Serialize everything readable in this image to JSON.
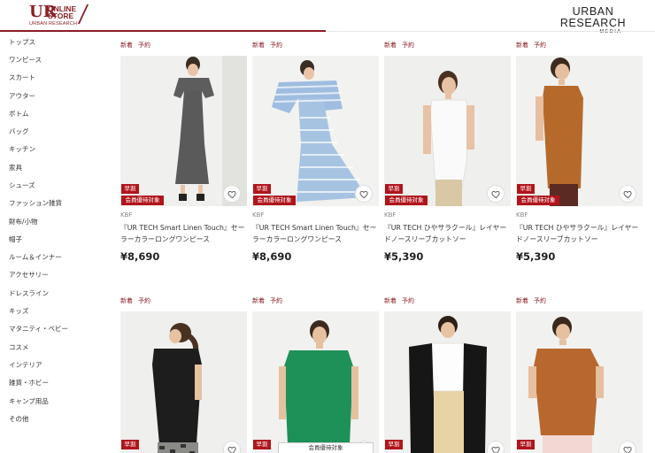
{
  "header": {
    "logo_ur": "UR",
    "logo_online": "ONLINE",
    "logo_store": "STORE",
    "logo_sub": "URBAN RESEARCH",
    "media_brand": "URBAN RESEARCH",
    "media_sub": "MEDIA"
  },
  "sidebar": {
    "items": [
      {
        "label": "トップス"
      },
      {
        "label": "ワンピース"
      },
      {
        "label": "スカート"
      },
      {
        "label": "アウター"
      },
      {
        "label": "ボトム"
      },
      {
        "label": "バッグ"
      },
      {
        "label": "キッチン"
      },
      {
        "label": "家具"
      },
      {
        "label": "シューズ"
      },
      {
        "label": "ファッション雑貨"
      },
      {
        "label": "財布/小物"
      },
      {
        "label": "帽子"
      },
      {
        "label": "ルーム＆インナー"
      },
      {
        "label": "アクセサリー"
      },
      {
        "label": "ドレスライン"
      },
      {
        "label": "キッズ"
      },
      {
        "label": "マタニティ・ベビー"
      },
      {
        "label": "コスメ"
      },
      {
        "label": "インテリア"
      },
      {
        "label": "雑貨・ホビー"
      },
      {
        "label": "キャンプ用品"
      },
      {
        "label": "その他"
      }
    ]
  },
  "products": [
    {
      "tag_new": "新着",
      "tag_reserve": "予約",
      "badge_early": "早割",
      "badge_member": "会員優待対象",
      "brand": "KBF",
      "name": "『UR TECH Smart Linen Touch』セーラーカラーロングワンピース",
      "price": "¥8,690"
    },
    {
      "tag_new": "新着",
      "tag_reserve": "予約",
      "badge_early": "早割",
      "badge_member": "会員優待対象",
      "brand": "KBF",
      "name": "『UR TECH Smart Linen Touch』セーラーカラーロングワンピース",
      "price": "¥8,690"
    },
    {
      "tag_new": "新着",
      "tag_reserve": "予約",
      "badge_early": "早割",
      "badge_member": "会員優待対象",
      "brand": "KBF",
      "name": "『UR TECH ひやサラクール』レイヤードノースリーブカットソー",
      "price": "¥5,390"
    },
    {
      "tag_new": "新着",
      "tag_reserve": "予約",
      "badge_early": "早割",
      "badge_member": "会員優待対象",
      "brand": "KBF",
      "name": "『UR TECH ひやサラクール』レイヤードノースリーブカットソー",
      "price": "¥5,390"
    },
    {
      "tag_new": "新着",
      "tag_reserve": "予約",
      "badge_early": "早割"
    },
    {
      "tag_new": "新着",
      "tag_reserve": "予約",
      "badge_early": "早割"
    },
    {
      "tag_new": "新着",
      "tag_reserve": "予約",
      "badge_early": "早割"
    },
    {
      "tag_new": "新着",
      "tag_reserve": "予約",
      "badge_early": "早割"
    }
  ],
  "popup_text": "会員優待対象",
  "colors": {
    "brand_red": "#8b1f26",
    "badge_red": "#b0151c"
  }
}
